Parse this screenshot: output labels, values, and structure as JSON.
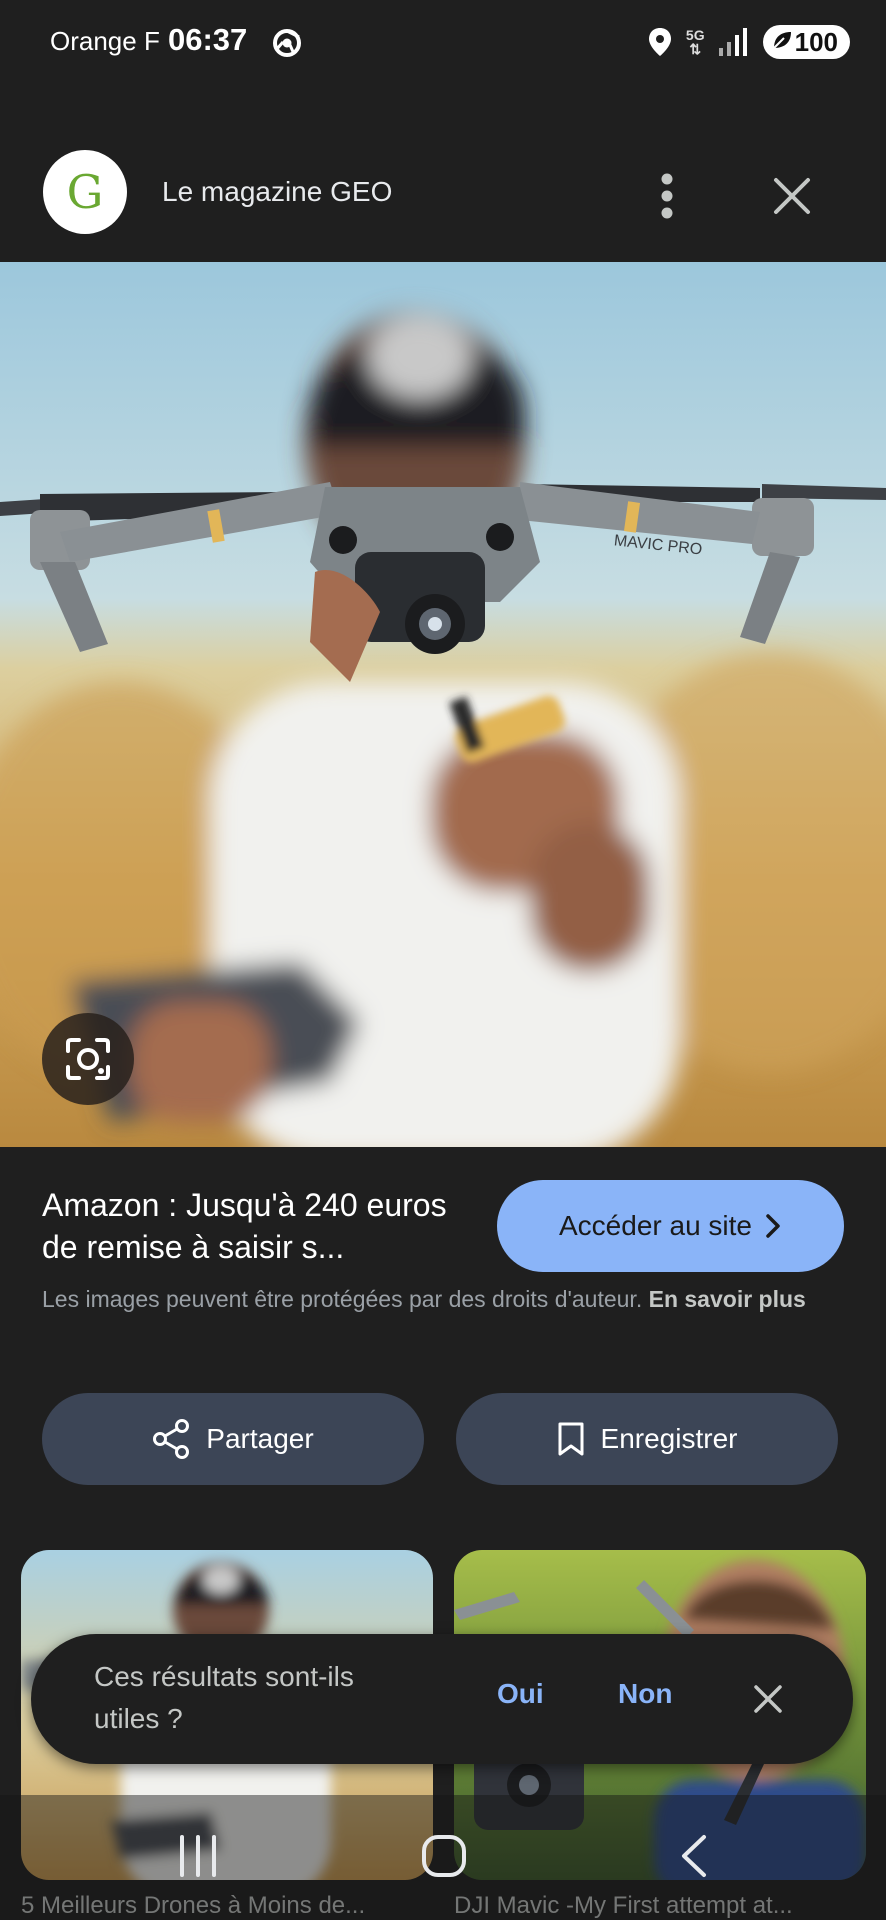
{
  "status_bar": {
    "carrier": "Orange F",
    "time": "06:37",
    "network": "5G",
    "battery": "100"
  },
  "header": {
    "logo_letter": "G",
    "site_name": "Le magazine GEO"
  },
  "result": {
    "title": "Amazon : Jusqu'à 240 euros de remise à saisir s...",
    "visit_label": "Accéder au site",
    "copyright_text": "Les images peuvent être protégées par des droits d'auteur.",
    "learn_more": "En savoir plus",
    "share_label": "Partager",
    "save_label": "Enregistrer"
  },
  "related": [
    {
      "caption": "5 Meilleurs Drones à Moins de..."
    },
    {
      "caption": "DJI Mavic -My First attempt at..."
    }
  ],
  "feedback": {
    "question": "Ces résultats sont-ils utiles ?",
    "yes": "Oui",
    "no": "Non"
  },
  "hero": {
    "drone_label": "MAVIC PRO"
  },
  "colors": {
    "background": "#1f1f1f",
    "accent": "#8ab4f8",
    "button_bg": "#3c4556"
  }
}
